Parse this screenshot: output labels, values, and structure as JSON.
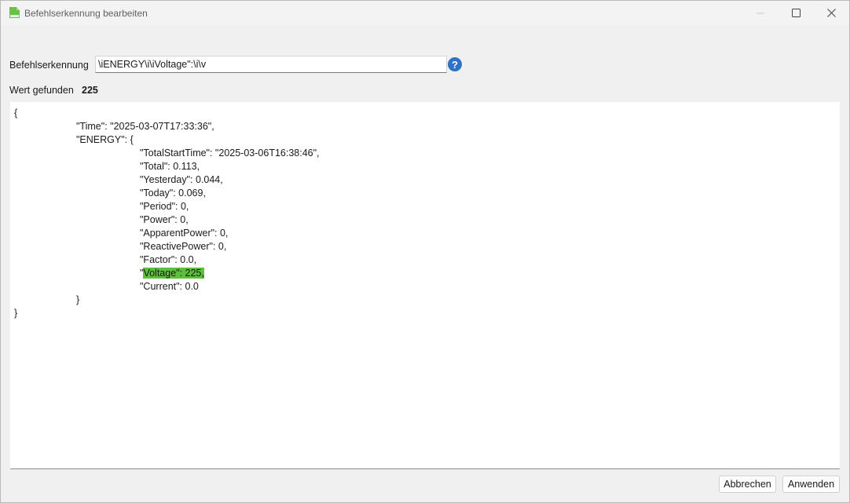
{
  "window": {
    "title": "Befehlserkennung bearbeiten",
    "app_icon": "document-green-icon",
    "controls": [
      "minimize-icon",
      "maximize-icon",
      "close-icon"
    ]
  },
  "form": {
    "command_label": "Befehlserkennung",
    "command_value": "\\iENERGY\\i\\iVoltage\":\\i\\v",
    "help_icon_glyph": "?",
    "found_label": "Wert gefunden",
    "found_value": "225"
  },
  "json_view": {
    "lines": [
      "{",
      "\"Time\": \"2025-03-07T17:33:36\",",
      "\"ENERGY\": {",
      "\"TotalStartTime\": \"2025-03-06T16:38:46\",",
      "\"Total\": 0.113,",
      "\"Yesterday\": 0.044,",
      "\"Today\": 0.069,",
      "\"Period\": 0,",
      "\"Power\": 0,",
      "\"ApparentPower\": 0,",
      "\"ReactivePower\": 0,",
      "\"Factor\": 0.0,",
      "\"",
      "\"Current\": 0.0",
      "}",
      "}"
    ],
    "highlight_text": "Voltage\": 225,",
    "highlight_color": "#5cbf3d"
  },
  "footer": {
    "cancel_label": "Abbrechen",
    "apply_label": "Anwenden"
  },
  "colors": {
    "help_blue": "#2f72c4",
    "highlight_green": "#5cbf3d"
  }
}
